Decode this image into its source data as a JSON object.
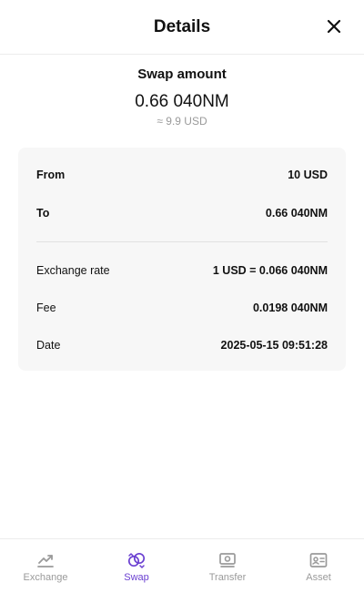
{
  "header": {
    "title": "Details"
  },
  "summary": {
    "label": "Swap amount",
    "amount": "0.66 040NM",
    "approx": "≈ 9.9 USD"
  },
  "details": {
    "from_label": "From",
    "from_value": "10 USD",
    "to_label": "To",
    "to_value": "0.66 040NM",
    "rate_label": "Exchange rate",
    "rate_value": "1 USD = 0.066 040NM",
    "fee_label": "Fee",
    "fee_value": "0.0198 040NM",
    "date_label": "Date",
    "date_value": "2025-05-15 09:51:28"
  },
  "nav": {
    "active": "Swap",
    "accent_color": "#6a3fd1",
    "items": [
      {
        "label": "Exchange",
        "icon": "trend-up-icon"
      },
      {
        "label": "Swap",
        "icon": "swap-icon"
      },
      {
        "label": "Transfer",
        "icon": "banknote-icon"
      },
      {
        "label": "Asset",
        "icon": "id-card-icon"
      }
    ]
  }
}
